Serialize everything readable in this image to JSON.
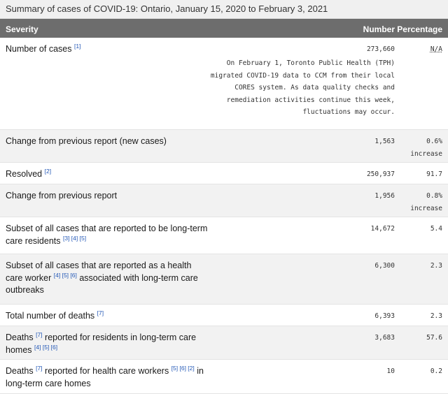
{
  "caption": "Summary of cases of COVID-19: Ontario, January 15, 2020 to February 3, 2021",
  "headers": {
    "severity": "Severity",
    "number": "Number",
    "percentage": "Percentage"
  },
  "rows": [
    {
      "label": "Number of cases",
      "refs": "[1]",
      "number": "273,660",
      "percentage": "N/A",
      "note": "On February 1, Toronto Public Health (TPH) migrated COVID-19 data to CCM from their local CORES system. As data quality checks and remediation activities continue this week, fluctuations may occur."
    },
    {
      "label": "Change from previous report (new cases)",
      "number": "1,563",
      "percentage": "0.6%",
      "percentage_sub": "increase"
    },
    {
      "label": "Resolved",
      "refs": "[2]",
      "number": "250,937",
      "percentage": "91.7"
    },
    {
      "label": "Change from previous report",
      "number": "1,956",
      "percentage": "0.8%",
      "percentage_sub": "increase"
    },
    {
      "label": "Subset of all cases that are reported to be long-term care residents",
      "refs": "[3] [4] [5]",
      "number": "14,672",
      "percentage": "5.4"
    },
    {
      "label_pre": "Subset of all cases that are reported as a health care worker",
      "refs": "[4] [5] [6]",
      "label_post": "associated with long-term care outbreaks",
      "number": "6,300",
      "percentage": "2.3"
    },
    {
      "label": "Total number of deaths",
      "refs": "[7]",
      "number": "6,393",
      "percentage": "2.3"
    },
    {
      "label_pre": "Deaths",
      "refs": "[7]",
      "label_post": "reported for residents in long-term care homes",
      "refs2": "[4] [5] [6]",
      "number": "3,683",
      "percentage": "57.6"
    },
    {
      "label_pre": "Deaths",
      "refs": "[7]",
      "label_post": "reported for health care workers",
      "refs2": "[5] [6] [2]",
      "label_post2": "in long-term care homes",
      "number": "10",
      "percentage": "0.2"
    }
  ]
}
